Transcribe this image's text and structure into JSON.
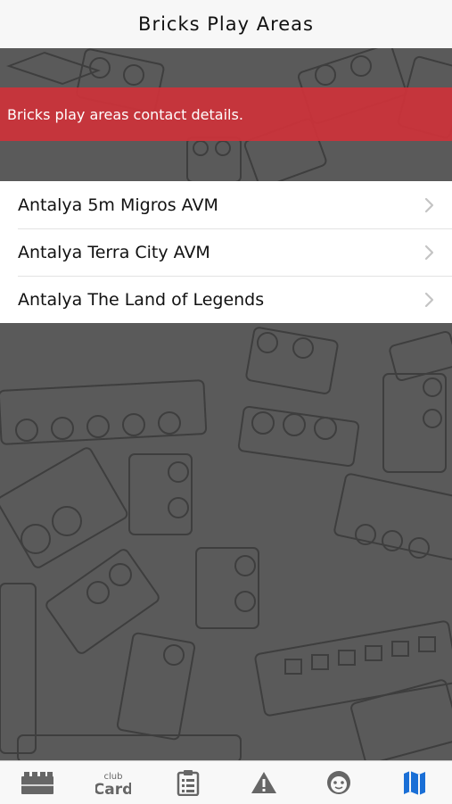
{
  "nav": {
    "title": "Bricks Play Areas"
  },
  "banner": {
    "text": "Bricks play areas contact details."
  },
  "locations": [
    {
      "label": "Antalya 5m Migros AVM"
    },
    {
      "label": "Antalya Terra City AVM"
    },
    {
      "label": "Antalya The Land of Legends"
    }
  ],
  "tabs": [
    {
      "icon": "bricks-icon",
      "active": false
    },
    {
      "icon": "club-card-icon",
      "active": false
    },
    {
      "icon": "clipboard-icon",
      "active": false
    },
    {
      "icon": "warning-icon",
      "active": false
    },
    {
      "icon": "smiley-icon",
      "active": false
    },
    {
      "icon": "map-icon",
      "active": true
    }
  ],
  "colors": {
    "banner": "#ce3239",
    "background": "#5a5a5a",
    "tab_inactive": "#666666",
    "tab_active": "#1a6fd6"
  }
}
